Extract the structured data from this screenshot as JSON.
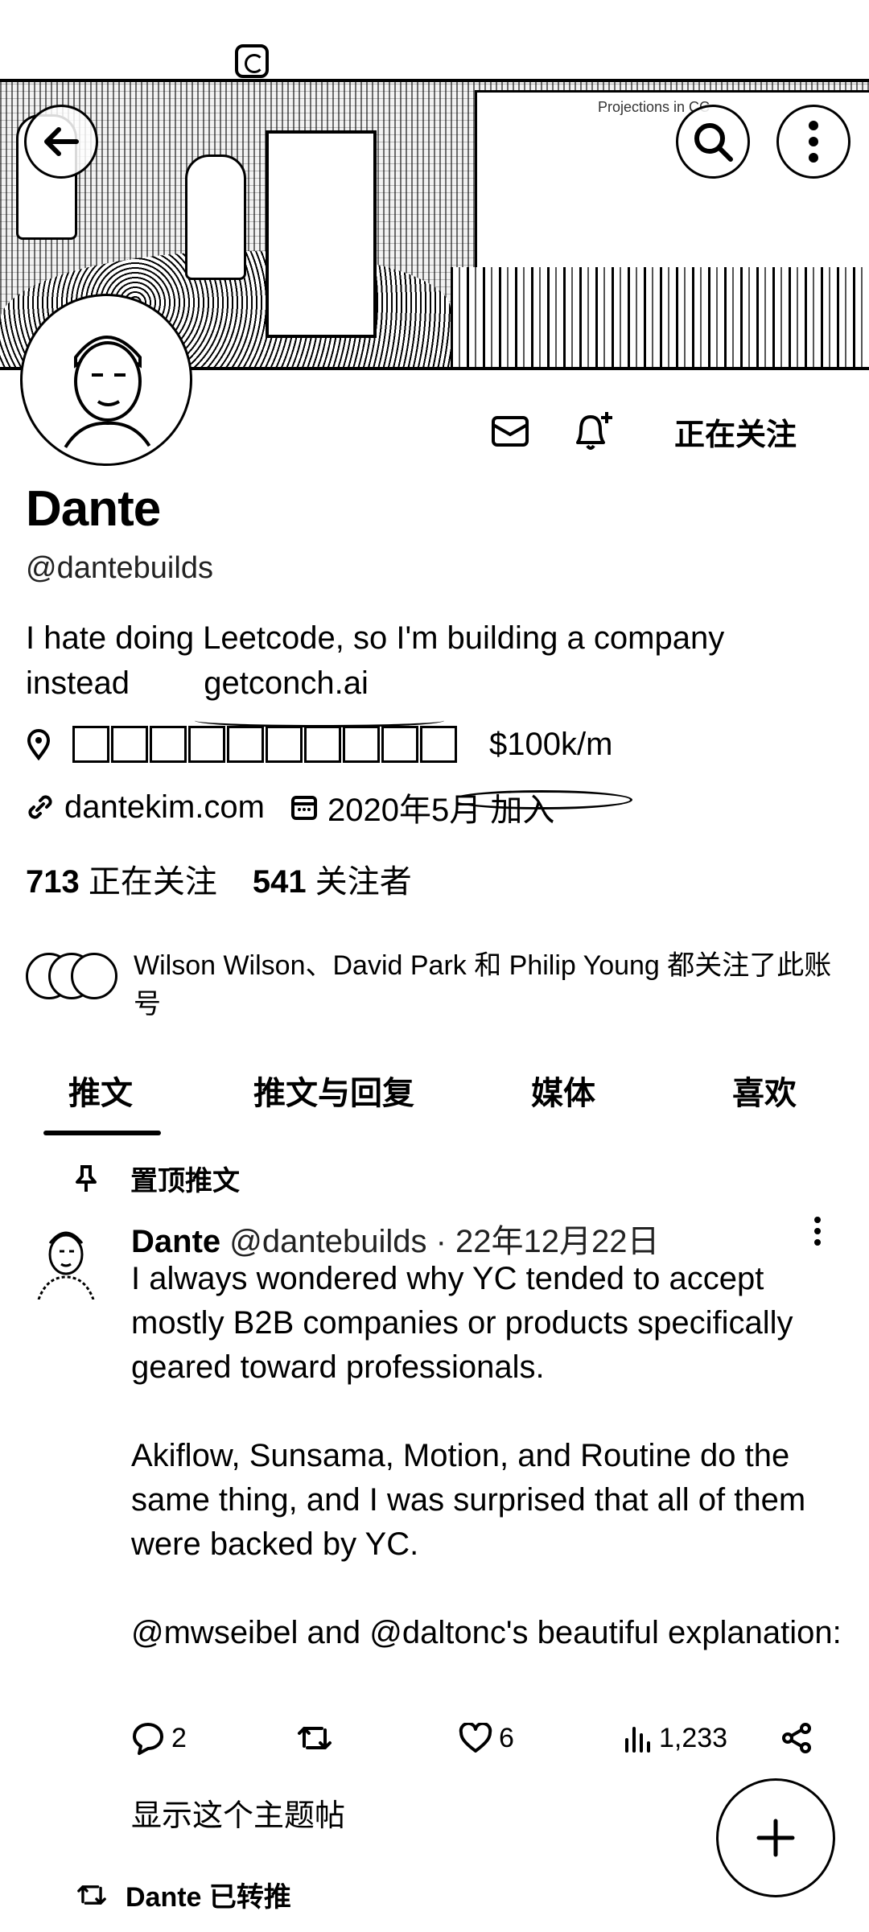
{
  "banner": {
    "panel_text": "Projections in CC"
  },
  "profile": {
    "name": "Dante",
    "handle": "@dantebuilds",
    "bio_line1": "I hate doing Leetcode, so I'm building a company",
    "bio_line2_prefix": "instead",
    "bio_link": "getconch.ai",
    "location_income": "$100k/m",
    "website": "dantekim.com",
    "joined": "2020年5月 加入",
    "following_button": "正在关注"
  },
  "counts": {
    "following_count": "713",
    "following_label": "正在关注",
    "followers_count": "541",
    "followers_label": "关注者"
  },
  "followed_by": "Wilson Wilson、David Park 和 Philip Young 都关注了此账号",
  "tabs": [
    "推文",
    "推文与回复",
    "媒体",
    "喜欢"
  ],
  "pinned": {
    "label": "置顶推文",
    "author": "Dante",
    "handle": "@dantebuilds",
    "date": "· 22年12月22日",
    "paragraphs": [
      "I always wondered why YC tended to accept mostly B2B companies or products specifically geared toward professionals.",
      "Akiflow, Sunsama, Motion, and Routine do the same thing, and I was surprised that all of them were backed by YC.",
      "@mwseibel and @daltonc's beautiful explanation:"
    ],
    "replies": "2",
    "likes": "6",
    "views": "1,233",
    "show_thread": "显示这个主题帖"
  },
  "retweet_label": "Dante 已转推",
  "colors": {
    "text": "#000000",
    "background": "#ffffff"
  }
}
